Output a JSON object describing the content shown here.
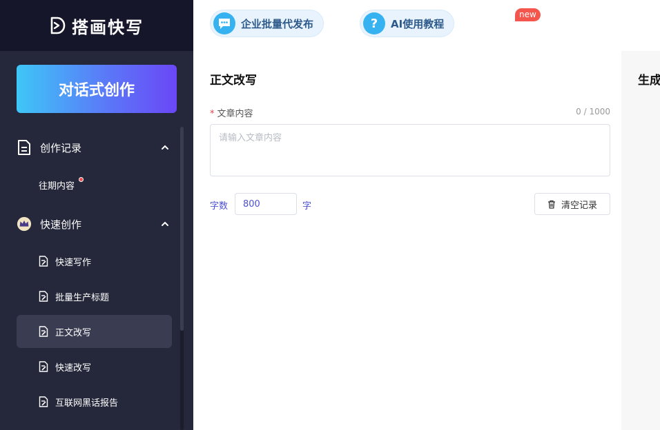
{
  "app": {
    "name": "搭画快写"
  },
  "sidebar": {
    "cta_label": "对话式创作",
    "group1": {
      "label": "创作记录",
      "items": [
        {
          "label": "往期内容"
        }
      ]
    },
    "group2": {
      "label": "快速创作",
      "items": [
        {
          "label": "快速写作"
        },
        {
          "label": "批量生产标题"
        },
        {
          "label": "正文改写"
        },
        {
          "label": "快速改写"
        },
        {
          "label": "互联网黑话报告"
        }
      ]
    }
  },
  "header": {
    "pill1": {
      "label": "企业批量代发布",
      "badge": "new",
      "icon": "chat-bubble-icon"
    },
    "pill2": {
      "label": "AI使用教程",
      "icon": "question-icon",
      "icon_glyph": "?"
    }
  },
  "main": {
    "title": "正文改写",
    "field": {
      "required_mark": "*",
      "label": "文章内容",
      "counter": "0 / 1000",
      "placeholder": "请输入文章内容",
      "value": ""
    },
    "word_count": {
      "label": "字数",
      "value": "800",
      "unit": "字"
    },
    "clear_label": "清空记录"
  },
  "right": {
    "title": "生成"
  },
  "colors": {
    "accent": "#4b4fd3",
    "sidebar_bg": "#25273a",
    "logo_bg": "#15162a",
    "badge": "#f4564e"
  }
}
